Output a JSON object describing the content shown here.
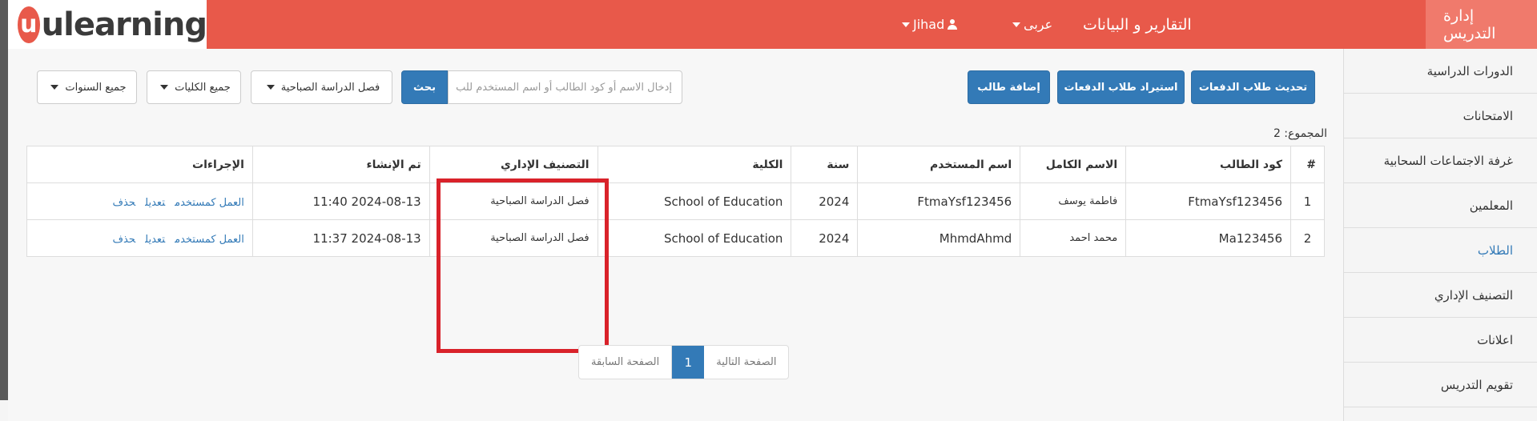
{
  "brand": {
    "logo_letter": "u",
    "logo_text": "ulearning"
  },
  "topnav": {
    "teaching_admin": "إدارة التدريس",
    "reports": "التقارير و البيانات",
    "language": "عربى",
    "user": "Jihad"
  },
  "sidebar": {
    "items": [
      {
        "label": "الدورات الدراسية"
      },
      {
        "label": "الامتحانات"
      },
      {
        "label": "غرفة الاجتماعات السحابية"
      },
      {
        "label": "المعلمين"
      },
      {
        "label": "الطلاب"
      },
      {
        "label": "التصنيف الإداري"
      },
      {
        "label": "اعلانات"
      },
      {
        "label": "تقويم التدريس"
      }
    ]
  },
  "toolbar": {
    "update_cohort": "تحديث طلاب الدفعات",
    "import_cohort": "استيراد طلاب الدفعات",
    "add_student": "إضافة طالب",
    "search_placeholder": "إدخال الاسم أو كود الطالب أو اسم المستخدم للب",
    "search_button": "بحث",
    "filter_class": "فصل الدراسة الصباحية",
    "filter_colleges": "جميع الكليات",
    "filter_years": "جميع السنوات"
  },
  "total_label": "المجموع: 2",
  "table": {
    "headers": {
      "index": "#",
      "student_code": "كود الطالب",
      "full_name": "الاسم الكامل",
      "username": "اسم المستخدم",
      "year": "سنة",
      "college": "الكلية",
      "admin_class": "التصنيف الإداري",
      "created": "تم الإنشاء",
      "actions": "الإجراءات"
    },
    "rows": [
      {
        "index": "1",
        "student_code": "FtmaYsf123456",
        "full_name": "فاطمة يوسف",
        "username": "FtmaYsf123456",
        "year": "2024",
        "college": "School of Education",
        "admin_class": "فصل الدراسة الصباحية",
        "created": "2024-08-13 11:40"
      },
      {
        "index": "2",
        "student_code": "Ma123456",
        "full_name": "محمد احمد",
        "username": "MhmdAhmd",
        "year": "2024",
        "college": "School of Education",
        "admin_class": "فصل الدراسة الصباحية",
        "created": "2024-08-13 11:37"
      }
    ],
    "actions": {
      "work_as_user": "العمل كمستخدم",
      "edit": "تعديل",
      "delete": "حذف"
    }
  },
  "pagination": {
    "prev": "الصفحة السابقة",
    "current": "1",
    "next": "الصفحة التالية"
  }
}
